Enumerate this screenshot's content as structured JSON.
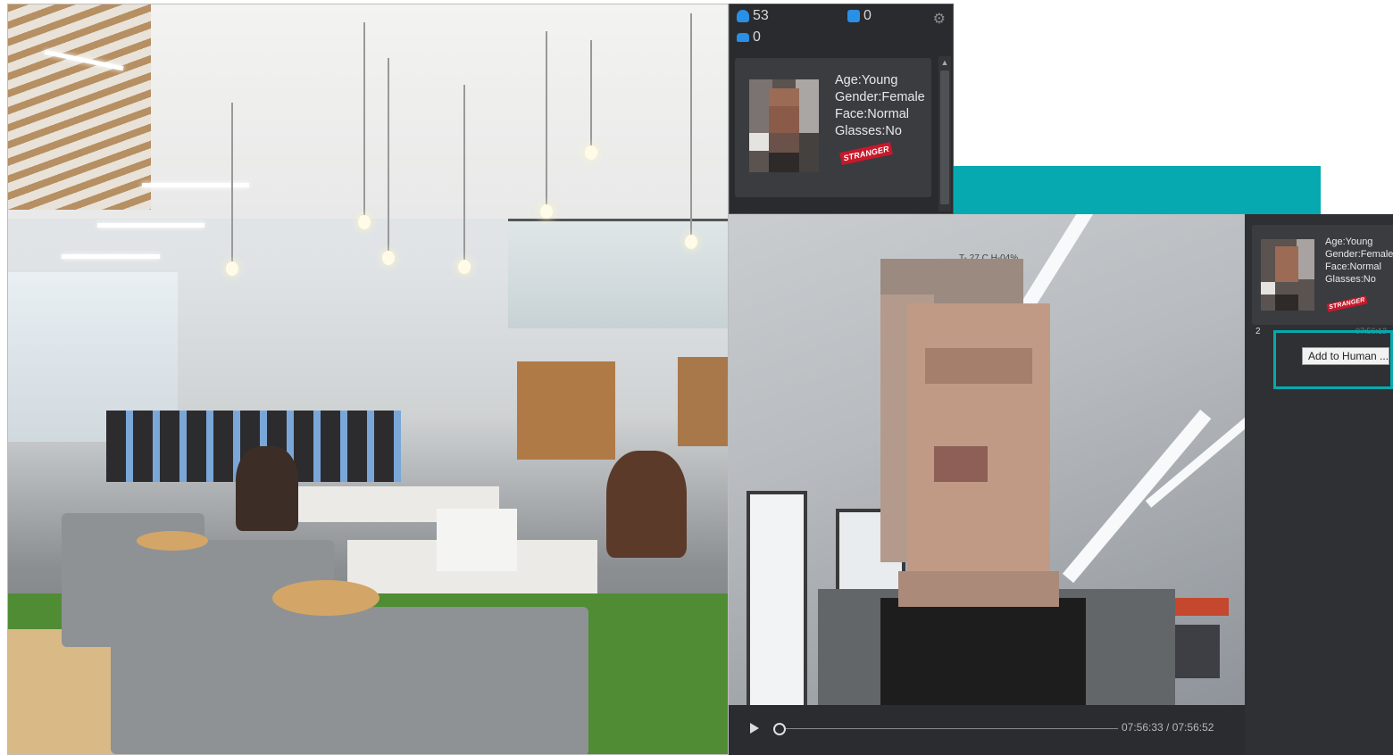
{
  "stats": {
    "person_count": "53",
    "pair_count": "0",
    "vehicle_count": "0"
  },
  "top_card": {
    "age": "Age:Young",
    "gender": "Gender:Female",
    "face": "Face:Normal",
    "glasses": "Glasses:No",
    "badge": "STRANGER"
  },
  "video": {
    "osd_text": "T- 27 C H-04%",
    "time": "07:56:33 / 07:56:52",
    "progress_fraction": 0.0
  },
  "side_card": {
    "age": "Age:Young",
    "gender": "Gender:Female",
    "face": "Face:Normal",
    "glasses": "Glasses:No",
    "badge": "STRANGER",
    "index": "2",
    "time": "07:56:13"
  },
  "actions": {
    "add_to_human": "Add to Human ..."
  },
  "icons": {
    "person": "person-icon",
    "pair": "people-pair-icon",
    "vehicle": "car-icon",
    "settings": "gear-icon"
  },
  "colors": {
    "accent_teal": "#07a9b0",
    "badge_red": "#c9182b",
    "panel_dark": "#2b2c2f",
    "icon_blue": "#2a8fe6"
  }
}
